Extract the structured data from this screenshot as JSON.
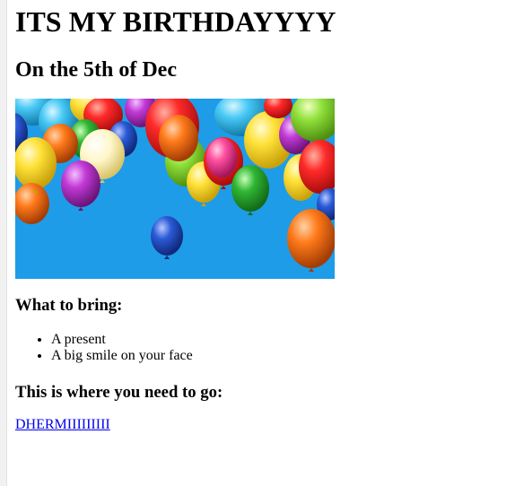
{
  "heading": "ITS MY BIRTHDAYYYY",
  "subheading": "On the 5th of Dec",
  "hero_image": {
    "depicts": "balloons",
    "background_color": "#1e9ce8",
    "balloon_colors": [
      "#ff2a2a",
      "#ffe23a",
      "#2fb533",
      "#2b5bd7",
      "#ff7a1a",
      "#c23ad6",
      "#ff4fa0",
      "#ffffff"
    ]
  },
  "bring_section": {
    "title": "What to bring:",
    "items": [
      "A present",
      "A big smile on your face"
    ]
  },
  "location_section": {
    "title": "This is where you need to go:",
    "link_text": "DHERMIIIIIIIII"
  },
  "colors": {
    "link": "#0000ee",
    "text": "#000000"
  }
}
